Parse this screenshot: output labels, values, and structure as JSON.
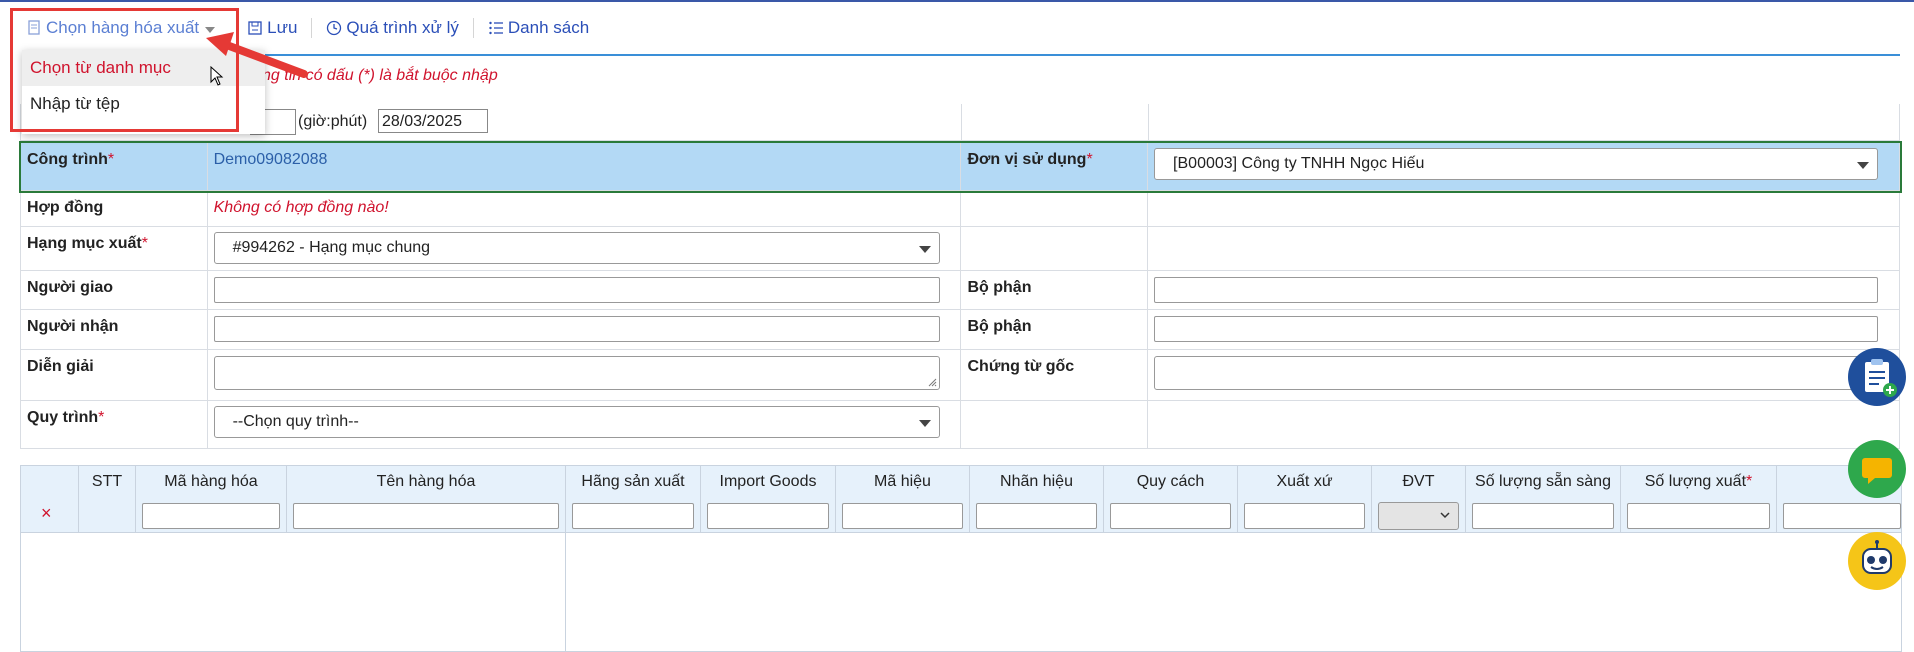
{
  "toolbar": {
    "choose_goods_label": "Chọn hàng hóa xuất",
    "save_label": "Lưu",
    "process_label": "Quá trình xử lý",
    "list_label": "Danh sách"
  },
  "dropdown": {
    "items": [
      {
        "label": "Chọn từ danh mục"
      },
      {
        "label": "Nhập từ tệp"
      }
    ]
  },
  "required_note": "ng tin có dấu (*) là bắt buộc nhập",
  "date_row": {
    "time_label": "(giờ:phút)",
    "date_value": "28/03/2025"
  },
  "form": {
    "project": {
      "label": "Công trình",
      "value": "Demo09082088"
    },
    "using_unit": {
      "label": "Đơn vị sử dụng",
      "value": "[B00003] Công ty TNHH Ngọc Hiếu"
    },
    "contract": {
      "label": "Hợp đồng",
      "value": "Không có hợp đồng nào!"
    },
    "export_item": {
      "label": "Hạng mục xuất",
      "value": "#994262 - Hạng mục chung"
    },
    "deliverer": {
      "label": "Người giao",
      "value": ""
    },
    "deliverer_dept": {
      "label": "Bộ phận",
      "value": ""
    },
    "receiver": {
      "label": "Người nhận",
      "value": ""
    },
    "receiver_dept": {
      "label": "Bộ phận",
      "value": ""
    },
    "description": {
      "label": "Diễn giải",
      "value": ""
    },
    "original_doc": {
      "label": "Chứng từ gốc",
      "value": ""
    },
    "workflow": {
      "label": "Quy trình",
      "value": "--Chọn quy trình--"
    },
    "required_mark": "*"
  },
  "grid": {
    "columns": [
      {
        "label": ""
      },
      {
        "label": "STT"
      },
      {
        "label": "Mã hàng hóa"
      },
      {
        "label": "Tên hàng hóa"
      },
      {
        "label": "Hãng sản xuất"
      },
      {
        "label": "Import Goods"
      },
      {
        "label": "Mã hiệu"
      },
      {
        "label": "Nhãn hiệu"
      },
      {
        "label": "Quy cách"
      },
      {
        "label": "Xuất xứ"
      },
      {
        "label": "ĐVT"
      },
      {
        "label": "Số lượng sẵn sàng"
      },
      {
        "label": "Số lượng xuất"
      },
      {
        "label": ""
      }
    ],
    "delete_symbol": "×"
  },
  "colors": {
    "accent": "#2b4fb8",
    "required": "#d0132d",
    "highlight_row": "#b3d9f5",
    "header_bg": "#e6f1fb",
    "annotation_red": "#e53935"
  },
  "icons": {
    "choose_goods": "document-icon",
    "save": "save-icon",
    "process": "clock-icon",
    "list": "list-icon",
    "fab_clipboard": "clipboard-add-icon",
    "fab_chat": "chat-icon",
    "fab_bot": "robot-icon"
  }
}
